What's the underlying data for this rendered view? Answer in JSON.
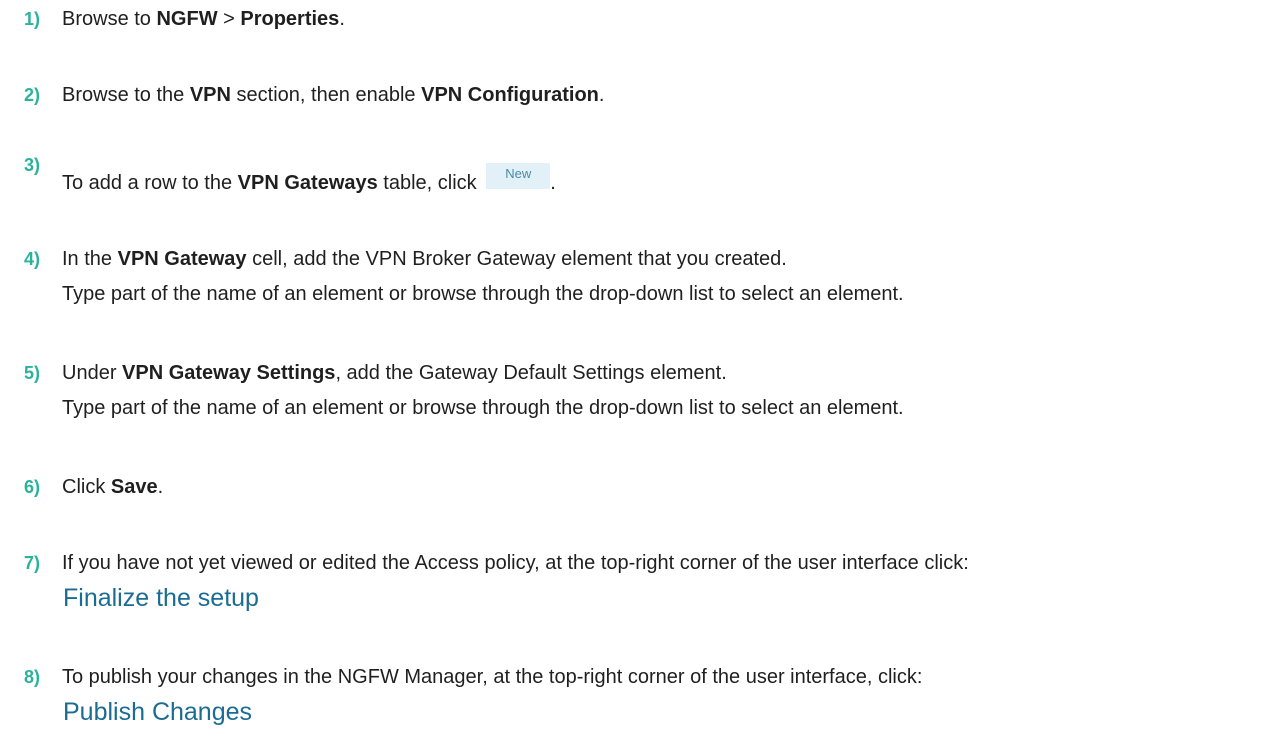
{
  "steps": [
    {
      "number": "1)",
      "parts": [
        {
          "t": "Browse to ",
          "b": false
        },
        {
          "t": "NGFW",
          "b": true
        },
        {
          "t": " > ",
          "b": false
        },
        {
          "t": "Properties",
          "b": true
        },
        {
          "t": ".",
          "b": false
        }
      ]
    },
    {
      "number": "2)",
      "parts": [
        {
          "t": "Browse to the ",
          "b": false
        },
        {
          "t": "VPN",
          "b": true
        },
        {
          "t": " section, then enable ",
          "b": false
        },
        {
          "t": "VPN Configuration",
          "b": true
        },
        {
          "t": ".",
          "b": false
        }
      ]
    },
    {
      "number": "3)",
      "parts_before": [
        {
          "t": "To add a row to the ",
          "b": false
        },
        {
          "t": "VPN Gateways",
          "b": true
        },
        {
          "t": " table, click ",
          "b": false
        }
      ],
      "button_label": "New",
      "after_button": "."
    },
    {
      "number": "4)",
      "parts": [
        {
          "t": "In the ",
          "b": false
        },
        {
          "t": "VPN Gateway",
          "b": true
        },
        {
          "t": " cell, add the VPN Broker Gateway element that you created.",
          "b": false
        }
      ],
      "second_line": "Type part of the name of an element or browse through the drop-down list to select an element."
    },
    {
      "number": "5)",
      "parts": [
        {
          "t": "Under ",
          "b": false
        },
        {
          "t": "VPN Gateway Settings",
          "b": true
        },
        {
          "t": ", add the Gateway Default Settings element.",
          "b": false
        }
      ],
      "second_line": "Type part of the name of an element or browse through the drop-down list to select an element."
    },
    {
      "number": "6)",
      "parts": [
        {
          "t": "Click ",
          "b": false
        },
        {
          "t": "Save",
          "b": true
        },
        {
          "t": ".",
          "b": false
        }
      ]
    },
    {
      "number": "7)",
      "parts": [
        {
          "t": "If you have not yet viewed or edited the Access policy, at the top-right corner of the user interface click:",
          "b": false
        }
      ],
      "action_label": "Finalize the setup"
    },
    {
      "number": "8)",
      "parts": [
        {
          "t": "To publish your changes in the NGFW Manager, at the top-right corner of the user interface, click:",
          "b": false
        }
      ],
      "action_label": "Publish Changes"
    }
  ],
  "colors": {
    "step_number": "#2bb39a",
    "link": "#1b6c93",
    "button_bg": "#e2f1f8",
    "button_text": "#4a8aa8"
  }
}
